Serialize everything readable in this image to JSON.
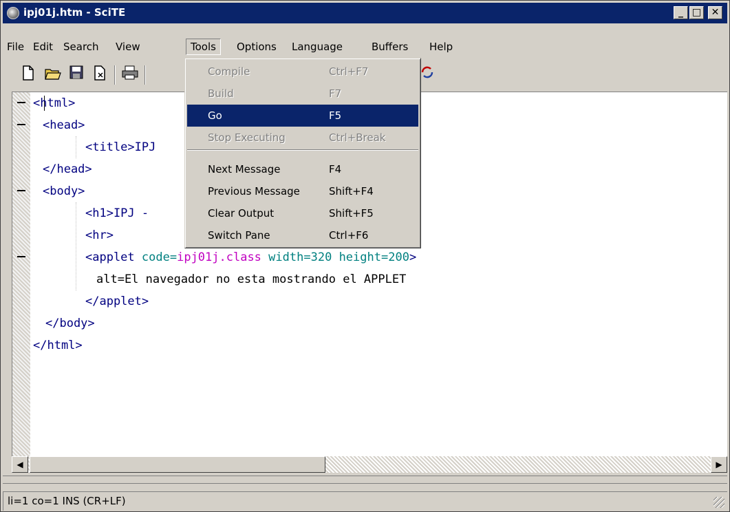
{
  "window": {
    "title": "ipj01j.htm - SciTE",
    "controls": {
      "minimize": "_",
      "maximize": "□",
      "close": "✕"
    }
  },
  "menu": [
    "File",
    "Edit",
    "Search",
    "View",
    "Tools",
    "Options",
    "Language",
    "Buffers",
    "Help"
  ],
  "active_menu": "Tools",
  "tools_menu": [
    {
      "label": "Compile",
      "shortcut": "Ctrl+F7",
      "state": "disabled"
    },
    {
      "label": "Build",
      "shortcut": "F7",
      "state": "disabled"
    },
    {
      "label": "Go",
      "shortcut": "F5",
      "state": "selected"
    },
    {
      "label": "Stop Executing",
      "shortcut": "Ctrl+Break",
      "state": "disabled"
    },
    {
      "label": "Next Message",
      "shortcut": "F4",
      "state": "enabled"
    },
    {
      "label": "Previous Message",
      "shortcut": "Shift+F4",
      "state": "enabled"
    },
    {
      "label": "Clear Output",
      "shortcut": "Shift+F5",
      "state": "enabled"
    },
    {
      "label": "Switch Pane",
      "shortcut": "Ctrl+F6",
      "state": "enabled"
    }
  ],
  "toolbar_icons": [
    "new-file-icon",
    "open-folder-icon",
    "save-icon",
    "close-file-icon",
    "print-icon",
    "macro-icon"
  ],
  "code": {
    "l1": "<html>",
    "l2": "<head>",
    "l3": "<title>IPJ",
    "l4": "</head>",
    "l5": "<body>",
    "l6": "<h1>IPJ -",
    "l7": "<hr>",
    "l8_tag": "<applet",
    "l8_attr1": "code=",
    "l8_val1": "ipj01j.class",
    "l8_attr2": "width=",
    "l8_val2": "320",
    "l8_attr3": "height=",
    "l8_val3": "200",
    "l8_end": ">",
    "l9": "alt=El navegador no esta mostrando el APPLET",
    "l10": "</applet>",
    "l11": "</body>",
    "l12": "</html>"
  },
  "status": "li=1 co=1 INS (CR+LF)"
}
